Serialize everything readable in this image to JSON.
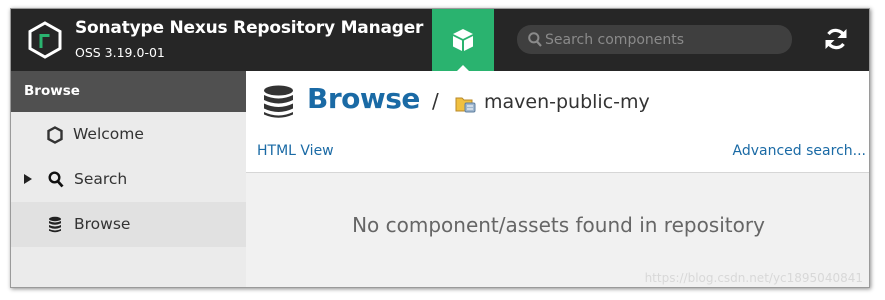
{
  "header": {
    "app_title": "Sonatype Nexus Repository Manager",
    "app_version": "OSS 3.19.0-01",
    "search_placeholder": "Search components",
    "icons": {
      "logo": "nexus-logo-icon",
      "browse_mode": "cube-icon",
      "search": "search-icon",
      "refresh": "refresh-icon"
    },
    "colors": {
      "background": "#262626",
      "browse_mode_active": "#2ab36f"
    }
  },
  "sidebar": {
    "header": "Browse",
    "items": [
      {
        "label": "Welcome",
        "icon": "hexagon-icon",
        "selected": false,
        "expandable": false
      },
      {
        "label": "Search",
        "icon": "search-icon",
        "selected": false,
        "expandable": true
      },
      {
        "label": "Browse",
        "icon": "database-icon",
        "selected": true,
        "expandable": false
      }
    ]
  },
  "main": {
    "title": "Browse",
    "breadcrumb_separator": "/",
    "repository": "maven-public-my",
    "html_view_link": "HTML View",
    "advanced_search_link": "Advanced search...",
    "empty_message": "No component/assets found in repository",
    "colors": {
      "title": "#1a6aa5",
      "link": "#1a6aa5"
    }
  },
  "watermark": "https://blog.csdn.net/yc1895040841"
}
